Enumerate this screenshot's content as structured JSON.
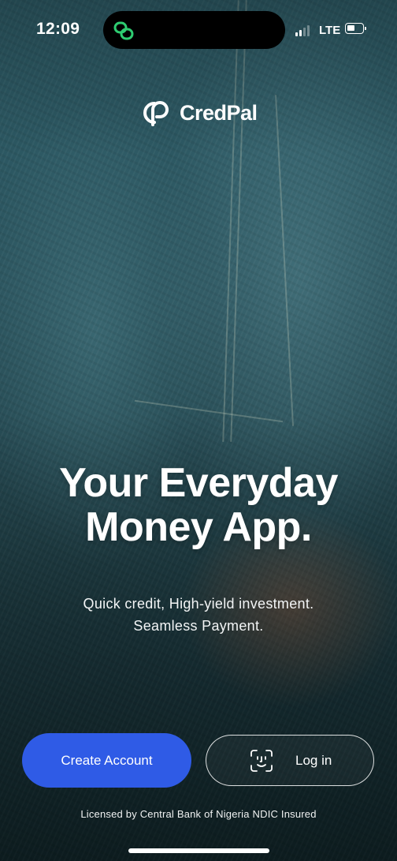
{
  "status_bar": {
    "time": "12:09",
    "network": "LTE",
    "signal_bars": 2,
    "battery_level": 0.4
  },
  "brand": {
    "name": "CredPal",
    "island_icon": "link-rings-icon",
    "island_icon_color": "#2ecc71"
  },
  "hero": {
    "headline_line1": "Your Everyday",
    "headline_line2": "Money App.",
    "subtitle_line1": "Quick credit, High-yield investment.",
    "subtitle_line2": "Seamless Payment."
  },
  "actions": {
    "create_account_label": "Create Account",
    "login_label": "Log in",
    "login_icon": "face-id-icon",
    "primary_color": "#2f5be6"
  },
  "footer": {
    "license_text": "Licensed by Central Bank of Nigeria NDIC Insured"
  }
}
